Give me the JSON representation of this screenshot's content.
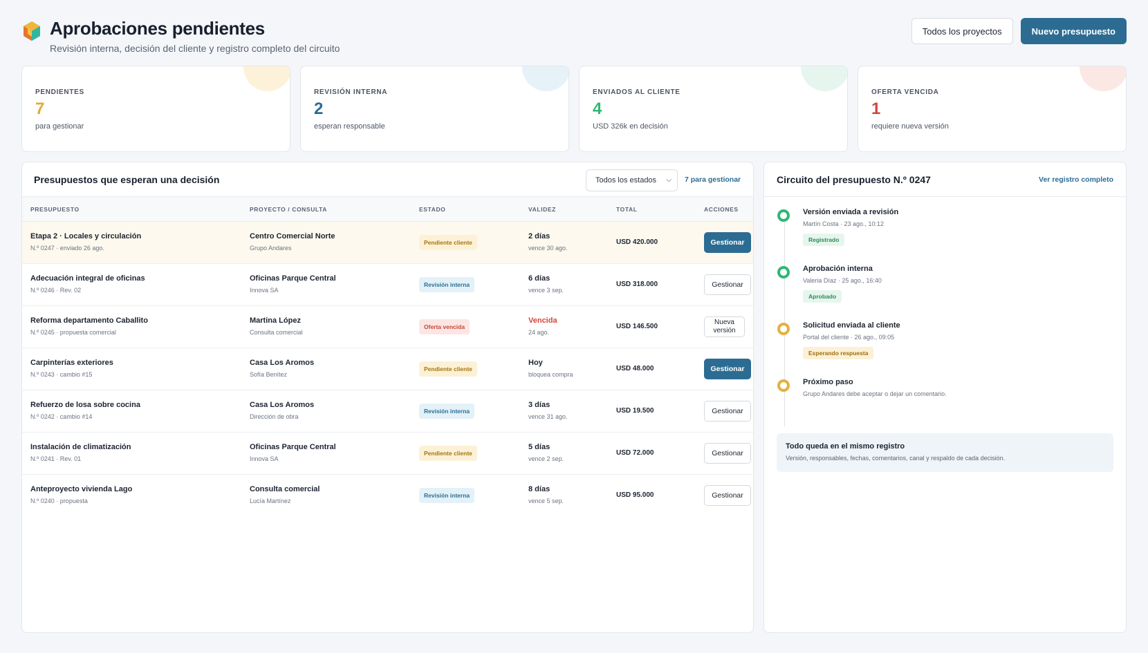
{
  "header": {
    "title": "Aprobaciones pendientes",
    "subtitle": "Revisión interna, decisión del cliente y registro completo del circuito",
    "btn_all_projects": "Todos los proyectos",
    "btn_new_budget": "Nuevo presupuesto"
  },
  "stats": [
    {
      "label": "PENDIENTES",
      "value": "7",
      "desc": "para gestionar",
      "color": "#e3aa39"
    },
    {
      "label": "REVISIÓN INTERNA",
      "value": "2",
      "desc": "esperan responsable",
      "color": "#2c6c93"
    },
    {
      "label": "ENVIADOS AL CLIENTE",
      "value": "4",
      "desc": "USD 326k en decisión",
      "color": "#2fb874"
    },
    {
      "label": "OFERTA VENCIDA",
      "value": "1",
      "desc": "requiere nueva versión",
      "color": "#d0473b"
    }
  ],
  "table": {
    "title": "Presupuestos que esperan una decisión",
    "filter": "Todos los estados",
    "manage_link": "7 para gestionar",
    "headers": [
      "PRESUPUESTO",
      "PROYECTO / CONSULTA",
      "ESTADO",
      "VALIDEZ",
      "TOTAL",
      "ACCIONES"
    ],
    "rows": [
      {
        "name": "Etapa 2 · Locales y circulación",
        "ref": "N.º 0247 · enviado 26 ago.",
        "project": "Centro Comercial Norte",
        "client": "Grupo Andares",
        "status": "Pendiente cliente",
        "validity": "2 días",
        "validity_sub": "vence 30 ago.",
        "total": "USD 420.000",
        "action": "Gestionar"
      },
      {
        "name": "Adecuación integral de oficinas",
        "ref": "N.º 0246 · Rev. 02",
        "project": "Oficinas Parque Central",
        "client": "Innova SA",
        "status": "Revisión interna",
        "validity": "6 días",
        "validity_sub": "vence 3 sep.",
        "total": "USD 318.000",
        "action": "Gestionar"
      },
      {
        "name": "Reforma departamento Caballito",
        "ref": "N.º 0245 · propuesta comercial",
        "project": "Martina López",
        "client": "Consulta comercial",
        "status": "Oferta vencida",
        "validity": "Vencida",
        "validity_sub": "24 ago.",
        "total": "USD 146.500",
        "action_l1": "Nueva",
        "action_l2": "versión"
      },
      {
        "name": "Carpinterías exteriores",
        "ref": "N.º 0243 · cambio #15",
        "project": "Casa Los Aromos",
        "client": "Sofía Benítez",
        "status": "Pendiente cliente",
        "validity": "Hoy",
        "validity_sub": "bloquea compra",
        "total": "USD 48.000",
        "action": "Gestionar"
      },
      {
        "name": "Refuerzo de losa sobre cocina",
        "ref": "N.º 0242 · cambio #14",
        "project": "Casa Los Aromos",
        "client": "Dirección de obra",
        "status": "Revisión interna",
        "validity": "3 días",
        "validity_sub": "vence 31 ago.",
        "total": "USD 19.500",
        "action": "Gestionar"
      },
      {
        "name": "Instalación de climatización",
        "ref": "N.º 0241 · Rev. 01",
        "project": "Oficinas Parque Central",
        "client": "Innova SA",
        "status": "Pendiente cliente",
        "validity": "5 días",
        "validity_sub": "vence 2 sep.",
        "total": "USD 72.000",
        "action": "Gestionar"
      },
      {
        "name": "Anteproyecto vivienda Lago",
        "ref": "N.º 0240 · propuesta",
        "project": "Consulta comercial",
        "client": "Lucía Martínez",
        "status": "Revisión interna",
        "validity": "8 días",
        "validity_sub": "vence 5 sep.",
        "total": "USD 95.000",
        "action": "Gestionar"
      }
    ]
  },
  "circuit": {
    "title": "Circuito del presupuesto N.º 0247",
    "link": "Ver registro completo",
    "steps": [
      {
        "title": "Versión enviada a revisión",
        "meta": "Martín Costa · 23 ago., 10:12",
        "badge": "Registrado"
      },
      {
        "title": "Aprobación interna",
        "meta": "Valeria Díaz · 25 ago., 16:40",
        "badge": "Aprobado"
      },
      {
        "title": "Solicitud enviada al cliente",
        "meta": "Portal del cliente · 26 ago., 09:05",
        "badge": "Esperando respuesta"
      },
      {
        "title": "Próximo paso",
        "meta": "Grupo Andares debe aceptar o dejar un comentario."
      }
    ],
    "note_title": "Todo queda en el mismo registro",
    "note_text": "Versión, responsables, fechas, comentarios, canal y respaldo de cada decisión."
  }
}
